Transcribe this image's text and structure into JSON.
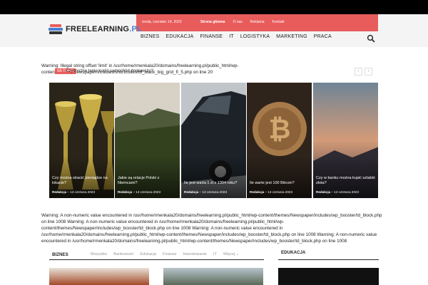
{
  "topbar": {
    "date": "środa, czerwiec 14, 2023",
    "links": [
      "Strona główna",
      "O nas",
      "Reklama",
      "Kontakt"
    ]
  },
  "logo": {
    "text": "FREELEARNING",
    "suffix": ".PL"
  },
  "nav": [
    "BIZNES",
    "EDUKACJA",
    "FINANSE",
    "IT",
    "LOGISTYKA",
    "MARKETING",
    "PRACA"
  ],
  "warning1": "Warning: Illegal string offset 'limit' in /usr/home/rmenkala20/domains/freelearning.pl/public_html/wp-content/themes/Newspaper/includes/shortcodes/td_block_big_grid_fl_5.php on line 20",
  "ticker": {
    "badge": "NA TOPIE",
    "headline": "Czy można tanio kupić samochód dostawczy?"
  },
  "grid": [
    {
      "title": "Czy można stracić pieniądze na lokacie?",
      "author": "Redakcja",
      "date": "13 czerwca 2023"
    },
    {
      "title": "Jakie są relacje Polski z Niemcami?",
      "author": "Redakcja",
      "date": "13 czerwca 2023"
    },
    {
      "title": "Ile jest warta 1 zł z 1994 roku?",
      "author": "Redakcja",
      "date": "13 czerwca 2023"
    },
    {
      "title": "Ile warte jest 100 Bitcoin?",
      "author": "Redakcja",
      "date": "13 czerwca 2023"
    },
    {
      "title": "Czy w banku można kupić sztabki złota?",
      "author": "Redakcja",
      "date": "12 czerwca 2023"
    }
  ],
  "warning2": "Warning: A non-numeric value encountered in /usr/home/rmenkala20/domains/freelearning.pl/public_html/wp-content/themes/Newspaper/includes/wp_booster/td_block.php on line 1008 Warning: A non-numeric value encountered in /usr/home/rmenkala20/domains/freelearning.pl/public_html/wp-content/themes/Newspaper/includes/wp_booster/td_block.php on line 1008 Warning: A non-numeric value encountered in /usr/home/rmenkala20/domains/freelearning.pl/public_html/wp-content/themes/Newspaper/includes/wp_booster/td_block.php on line 1008 Warning: A non-numeric value encountered in /usr/home/rmenkala20/domains/freelearning.pl/public_html/wp-content/themes/Newspaper/includes/wp_booster/td_block.php on line 1008",
  "section": {
    "title": "BIZNES",
    "tabs": [
      "Wszystko",
      "Bankowość",
      "Edukacja",
      "Finanse",
      "Inwestowanie",
      "IT"
    ],
    "more": "Więcej"
  },
  "sidebar_title": "EDUKACJA",
  "colors": {
    "accent": "#e85c5c",
    "logo_blue": "#4a7fd0"
  }
}
